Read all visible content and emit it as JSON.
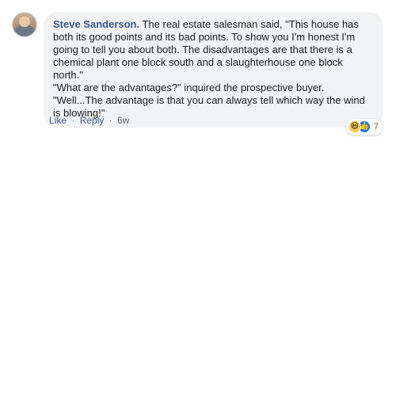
{
  "comment": {
    "author": "Steve Sanderson.",
    "text": " The real estate salesman said, \"This house has both its good points and its bad points. To show you I'm honest I'm going to tell you about both. The disadvantages are that there is a chemical plant one block south and a slaughterhouse one block north.\"\n\"What are the advantages?\" inquired the prospective buyer.\n\"Well...The advantage is that you can always tell which way the wind is blowing!\"",
    "reactions": {
      "icons": [
        "haha-icon",
        "like-icon"
      ],
      "count": "7",
      "haha_glyph": "😆",
      "like_glyph": "👍"
    },
    "actions": {
      "like_label": "Like",
      "reply_label": "Reply",
      "separator": "·",
      "timestamp": "6w"
    }
  },
  "colors": {
    "author": "#385898",
    "bubble": "#f2f3f5",
    "like_blue": "#1877f2",
    "haha_yellow": "#f7c84a"
  }
}
